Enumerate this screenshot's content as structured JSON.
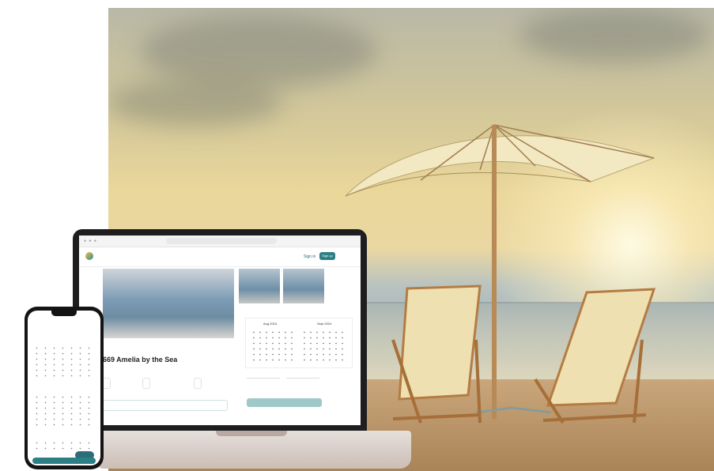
{
  "browser": {
    "controls": "● ● ●"
  },
  "site": {
    "logo_label": "",
    "sign_in_label": "Sign in",
    "sign_up_label": "Sign up"
  },
  "property": {
    "title": "669 Amelia by the Sea",
    "subtitle": "",
    "features": [
      "",
      "",
      ""
    ],
    "amenities_label": "",
    "amenity_item": ""
  },
  "booking": {
    "months": [
      "Aug 2024",
      "Sept 2024"
    ],
    "check_in_label": "",
    "check_out_label": "",
    "guests_label": "",
    "book_button_label": ""
  },
  "phone": {
    "time": "",
    "header": "",
    "months": [
      "",
      "",
      ""
    ],
    "button_label": "",
    "chat_label": ""
  },
  "colors": {
    "brand_teal": "#2d7f86",
    "light_teal": "#9ec9c8"
  }
}
